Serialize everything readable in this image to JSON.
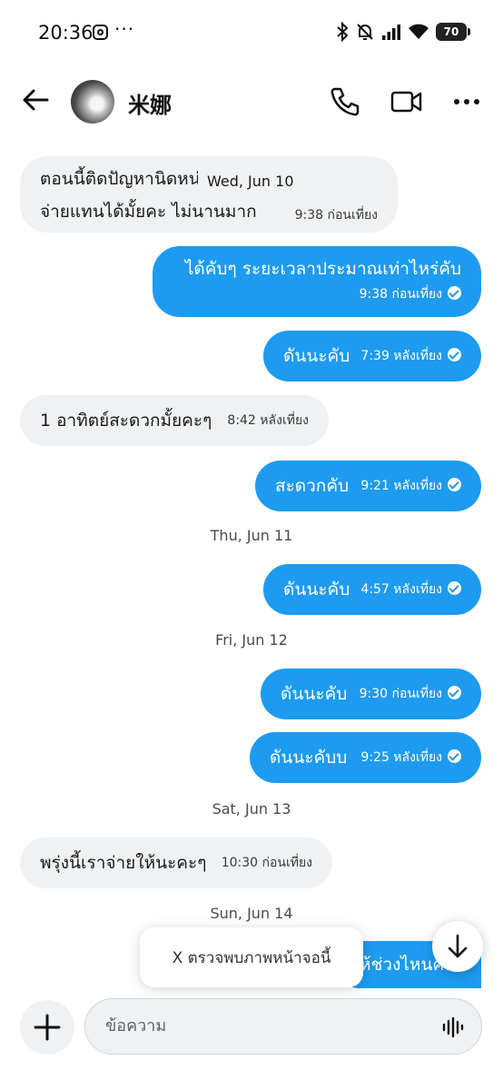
{
  "status_bar": {
    "time": "20:36",
    "dots": "···",
    "battery": "70"
  },
  "header": {
    "contact_name": "米娜"
  },
  "overlay_date": "Wed, Jun 10",
  "messages": [
    {
      "dir": "in",
      "lines": [
        "ตอนนี้ติดปัญหานิดหน่อยช่วยเทยอย",
        "จ่ายแทนได้มั้ยคะ ไม่นานมาก"
      ],
      "time": "9:38 ก่อนเที่ยง"
    },
    {
      "dir": "out",
      "lines": [
        "ได้คับๆ ระยะเวลาประมาณเท่าไหร่คับ"
      ],
      "time": "9:38 ก่อนเที่ยง"
    },
    {
      "dir": "out",
      "lines": [
        "ดันนะคับ"
      ],
      "time": "7:39 หลังเที่ยง"
    },
    {
      "dir": "in",
      "lines": [
        "1 อาทิตย์สะดวกมั้ยคะๆ"
      ],
      "time": "8:42 หลังเที่ยง"
    },
    {
      "dir": "out",
      "lines": [
        "สะดวกคับ"
      ],
      "time": "9:21 หลังเที่ยง"
    },
    {
      "dir": "out",
      "lines": [
        "ดันนะคับ"
      ],
      "time": "4:57 หลังเที่ยง"
    },
    {
      "dir": "out",
      "lines": [
        "ดันนะคับ"
      ],
      "time": "9:30 ก่อนเที่ยง"
    },
    {
      "dir": "out",
      "lines": [
        "ดันนะคับบ"
      ],
      "time": "9:25 หลังเที่ยง"
    },
    {
      "dir": "in",
      "lines": [
        "พรุ่งนี้เราจ่ายให้นะคะๆ"
      ],
      "time": "10:30 ก่อนเที่ยง"
    },
    {
      "dir": "out",
      "lines": [
        "ห้ช่วงไหนคับ"
      ],
      "time": ""
    }
  ],
  "date_separators": [
    "Thu, Jun 11",
    "Fri, Jun 12",
    "Sat, Jun 13",
    "Sun, Jun 14"
  ],
  "toast": {
    "text": "X ตรวจพบภาพหน้าจอนี้"
  },
  "composer": {
    "placeholder": "ข้อความ",
    "value": ""
  },
  "colors": {
    "accent": "#1d9bf0",
    "incoming_bg": "#eff1f2"
  }
}
